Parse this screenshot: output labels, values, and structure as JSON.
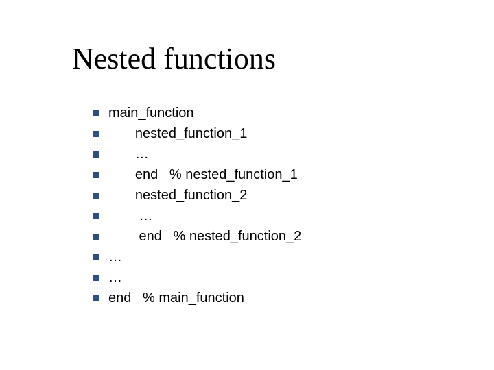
{
  "title": "Nested functions",
  "lines": [
    "main_function",
    "       nested_function_1",
    "       …",
    "       end   % nested_function_1",
    "       nested_function_2",
    "        …",
    "        end   % nested_function_2",
    "…",
    "…",
    "end   % main_function"
  ]
}
